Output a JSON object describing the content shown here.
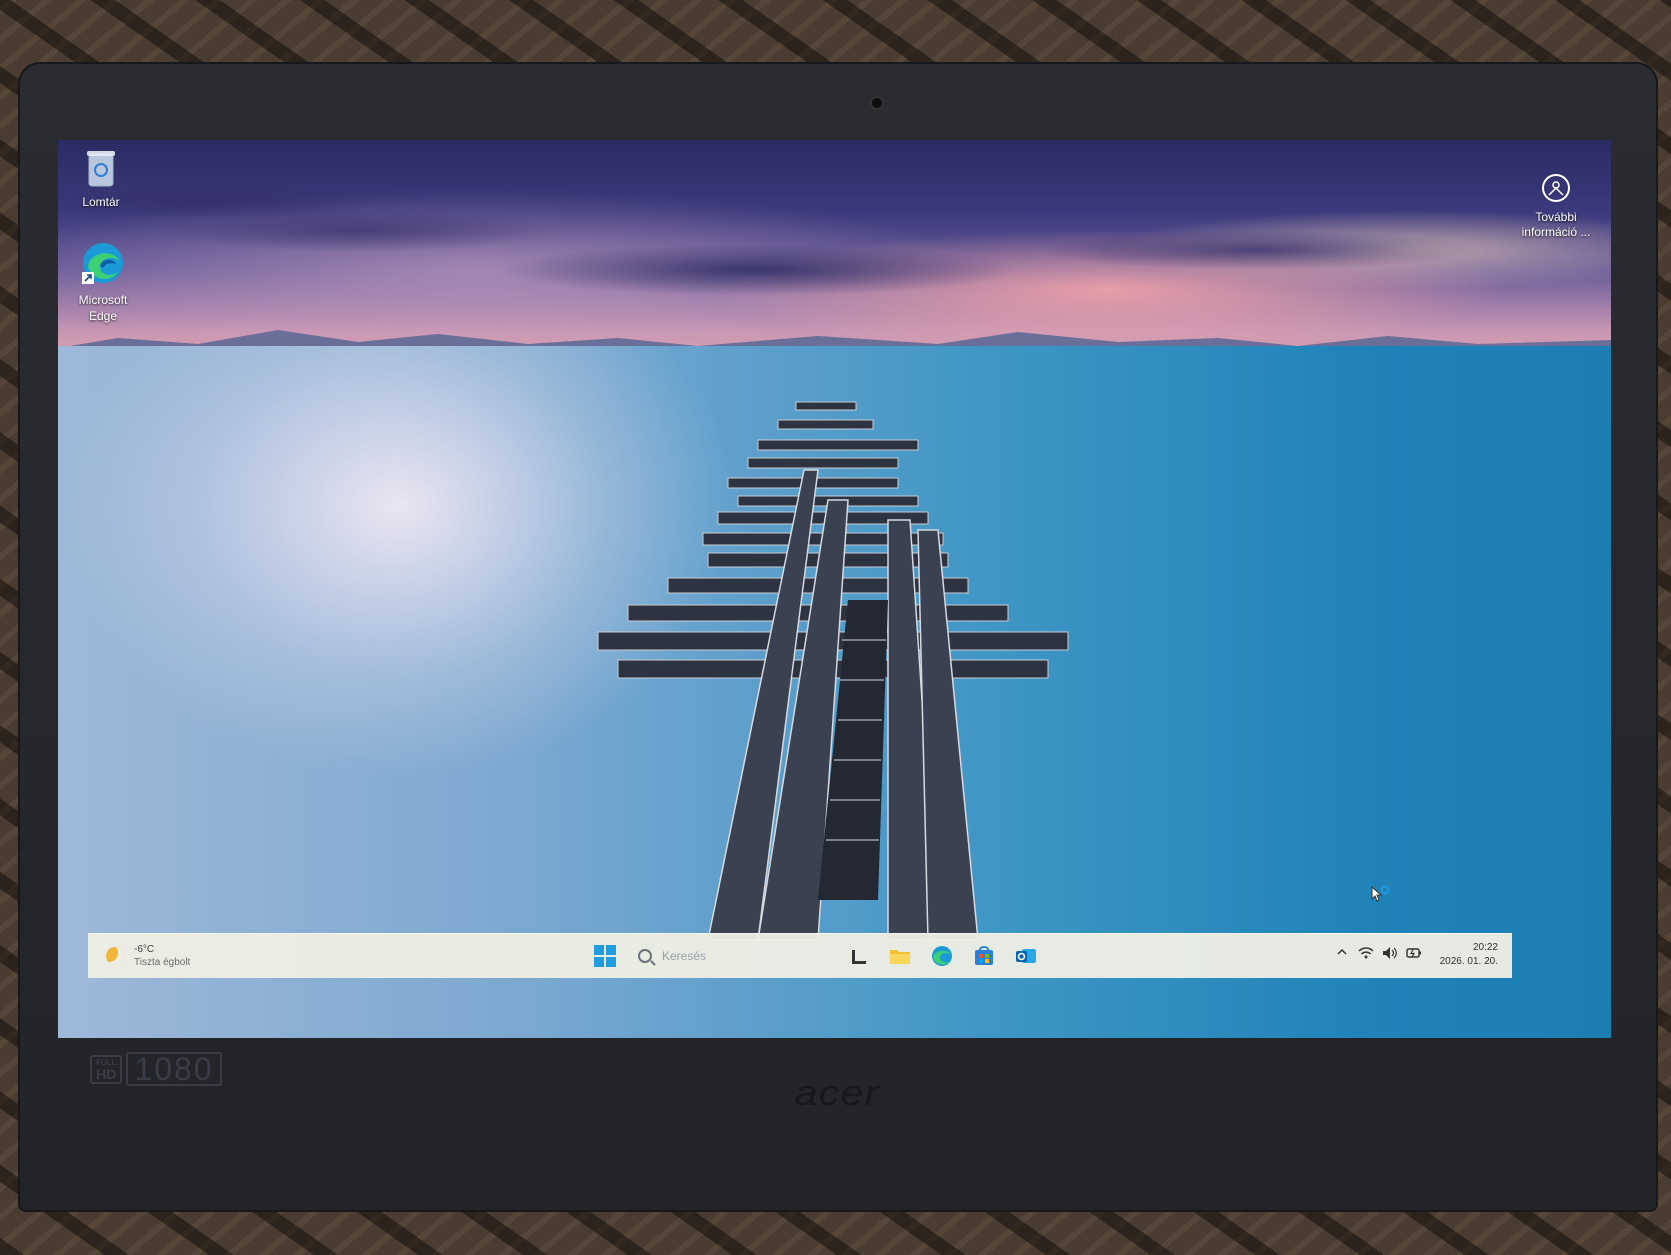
{
  "desktop": {
    "icons": [
      {
        "label": "Lomtár",
        "icon": "recycle-bin-icon"
      },
      {
        "label": "Microsoft Edge",
        "icon": "edge-icon"
      }
    ],
    "info_widget": {
      "label": "További információ ...",
      "icon": "info-camera-icon"
    }
  },
  "taskbar": {
    "weather": {
      "temperature": "-6°C",
      "condition": "Tiszta égbolt",
      "icon": "moon-icon"
    },
    "start": {
      "icon": "windows-start-icon",
      "accent": "#1f9be0"
    },
    "search": {
      "placeholder": "Keresés"
    },
    "pinned": [
      {
        "icon": "task-view-icon"
      },
      {
        "icon": "file-explorer-icon"
      },
      {
        "icon": "edge-icon"
      },
      {
        "icon": "microsoft-store-icon"
      },
      {
        "icon": "outlook-icon"
      }
    ],
    "tray": {
      "icons": [
        "chevron-up-icon",
        "wifi-icon",
        "volume-icon",
        "battery-icon"
      ],
      "time": "20:22",
      "date": "2026. 01. 20."
    }
  },
  "bezel": {
    "badge_top": "FULL",
    "badge_bottom": "HD",
    "resolution": "1080",
    "brand": "acer"
  }
}
